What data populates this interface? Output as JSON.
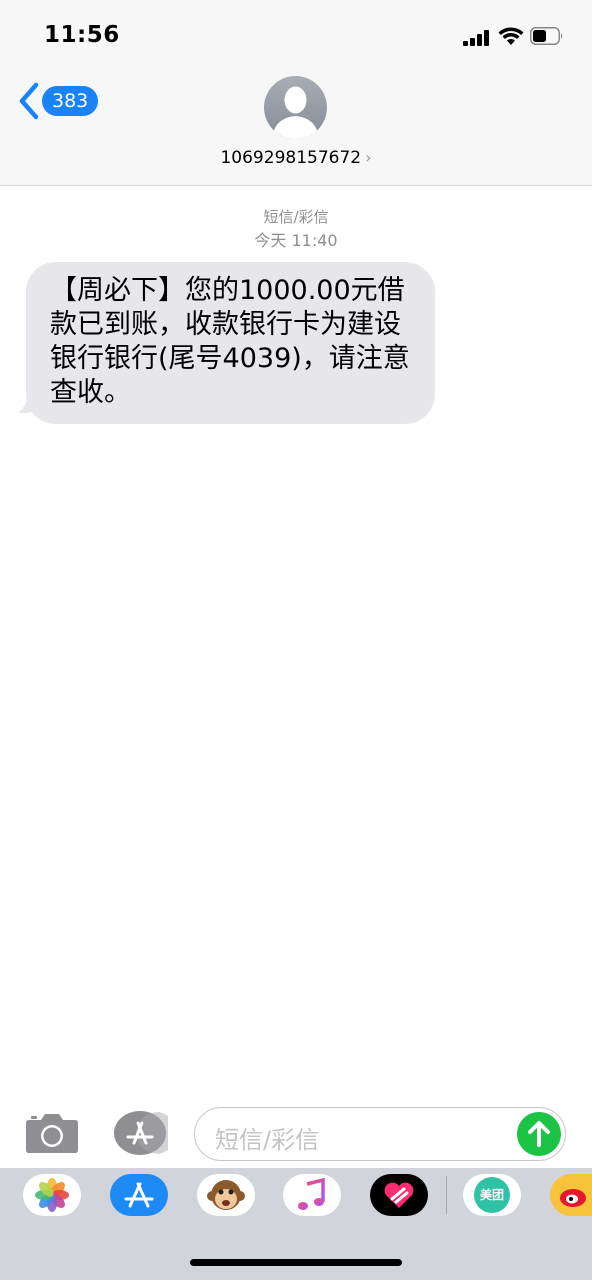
{
  "status_bar": {
    "time": "11:56"
  },
  "header": {
    "back_count": "383",
    "contact_number": "1069298157672",
    "chevron": "›"
  },
  "conversation": {
    "service_label": "短信/彩信",
    "timestamp": "今天 11:40",
    "message_text": "【周必下】您的1000.00元借款已到账，收款银行卡为建设银行银行(尾号4039)，请注意查收。"
  },
  "input_bar": {
    "placeholder": "短信/彩信"
  },
  "app_drawer": {
    "apps": [
      {
        "icon": "photos-icon"
      },
      {
        "icon": "app-store-icon"
      },
      {
        "icon": "animoji-monkey-icon"
      },
      {
        "icon": "music-icon"
      },
      {
        "icon": "digital-touch-icon"
      },
      {
        "icon": "meituan-icon",
        "label": "美团"
      },
      {
        "icon": "weibo-icon"
      }
    ]
  },
  "colors": {
    "accent_blue": "#1a82fb",
    "send_green": "#1cc446",
    "bubble_gray": "#e6e6eb",
    "meta_gray": "#8e8e93"
  }
}
